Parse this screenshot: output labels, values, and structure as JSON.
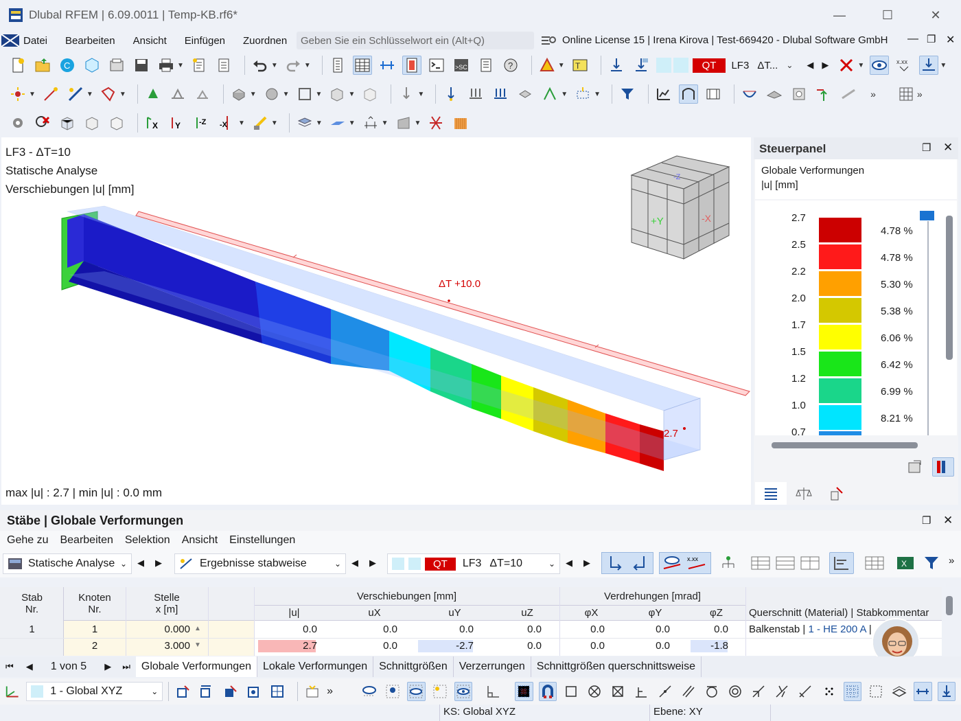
{
  "window": {
    "title": "Dlubal RFEM | 6.09.0011 | Temp-KB.rf6*"
  },
  "menu": {
    "items": [
      "Datei",
      "Bearbeiten",
      "Ansicht",
      "Einfügen",
      "Zuordnen"
    ],
    "more": "»"
  },
  "search": {
    "placeholder": "Geben Sie ein Schlüsselwort ein (Alt+Q)"
  },
  "license": "Online License 15 | Irena Kirova | Test-669420 - Dlubal Software GmbH",
  "toolbar": {
    "qt_label": "QT",
    "lc_label": "LF3",
    "lc_short": "ΔT..."
  },
  "viewport": {
    "lines": [
      "LF3 - ΔT=10",
      "Statische Analyse",
      "Verschiebungen |u| [mm]"
    ],
    "load_label": "ΔT +10.0",
    "max_label": "2.7",
    "footer": "max |u| : 2.7 | min |u| : 0.0 mm"
  },
  "panel": {
    "title": "Steuerpanel",
    "heading": "Globale Verformungen",
    "unit": "|u| [mm]",
    "values": [
      "2.7",
      "2.5",
      "2.2",
      "2.0",
      "1.7",
      "1.5",
      "1.2",
      "1.0",
      "0.7"
    ],
    "percents": [
      "4.78 %",
      "4.78 %",
      "5.30 %",
      "5.38 %",
      "6.06 %",
      "6.42 %",
      "6.99 %",
      "8.21 %"
    ],
    "colors": [
      "#cc0000",
      "#ff1a1a",
      "#ffa000",
      "#d4c800",
      "#ffff00",
      "#19e619",
      "#1ad68a",
      "#00e5ff"
    ]
  },
  "results": {
    "title": "Stäbe | Globale Verformungen",
    "menu": [
      "Gehe zu",
      "Bearbeiten",
      "Selektion",
      "Ansicht",
      "Einstellungen"
    ],
    "analysis": "Statische Analyse",
    "mode": "Ergebnisse stabweise",
    "qt_label": "QT",
    "lc": "LF3",
    "lc_name": "ΔT=10",
    "group_disp": "Verschiebungen [mm]",
    "group_rot": "Verdrehungen [mrad]",
    "headers": {
      "stab": [
        "Stab",
        "Nr."
      ],
      "knoten": [
        "Knoten",
        "Nr."
      ],
      "stelle": [
        "Stelle",
        "x [m]"
      ],
      "u": "|u|",
      "ux": "uX",
      "uy": "uY",
      "uz": "uZ",
      "px": "φX",
      "py": "φY",
      "pz": "φZ",
      "qs": "Querschnitt (Material) | Stabkommentar"
    },
    "rows": [
      {
        "stab": "1",
        "knoten": "1",
        "x": "0.000",
        "u": "0.0",
        "ux": "0.0",
        "uy": "0.0",
        "uz": "0.0",
        "px": "0.0",
        "py": "0.0",
        "pz": "0.0",
        "qs_prefix": "Balkenstab | ",
        "qs_link": "1 - HE 200 A",
        "qs_suffix": " | ...m"
      },
      {
        "stab": "",
        "knoten": "2",
        "x": "3.000",
        "u": "2.7",
        "ux": "0.0",
        "uy": "-2.7",
        "uz": "0.0",
        "px": "0.0",
        "py": "0.0",
        "pz": "-1.8",
        "qs_prefix": "",
        "qs_link": "",
        "qs_suffix": ""
      }
    ],
    "pager": "1 von 5",
    "tabs": [
      "Globale Verformungen",
      "Lokale Verformungen",
      "Schnittgrößen",
      "Verzerrungen",
      "Schnittgrößen querschnittsweise"
    ]
  },
  "bottom": {
    "cs": "1 - Global XYZ"
  },
  "status": {
    "ks": "KS: Global XYZ",
    "ebene": "Ebene: XY"
  }
}
